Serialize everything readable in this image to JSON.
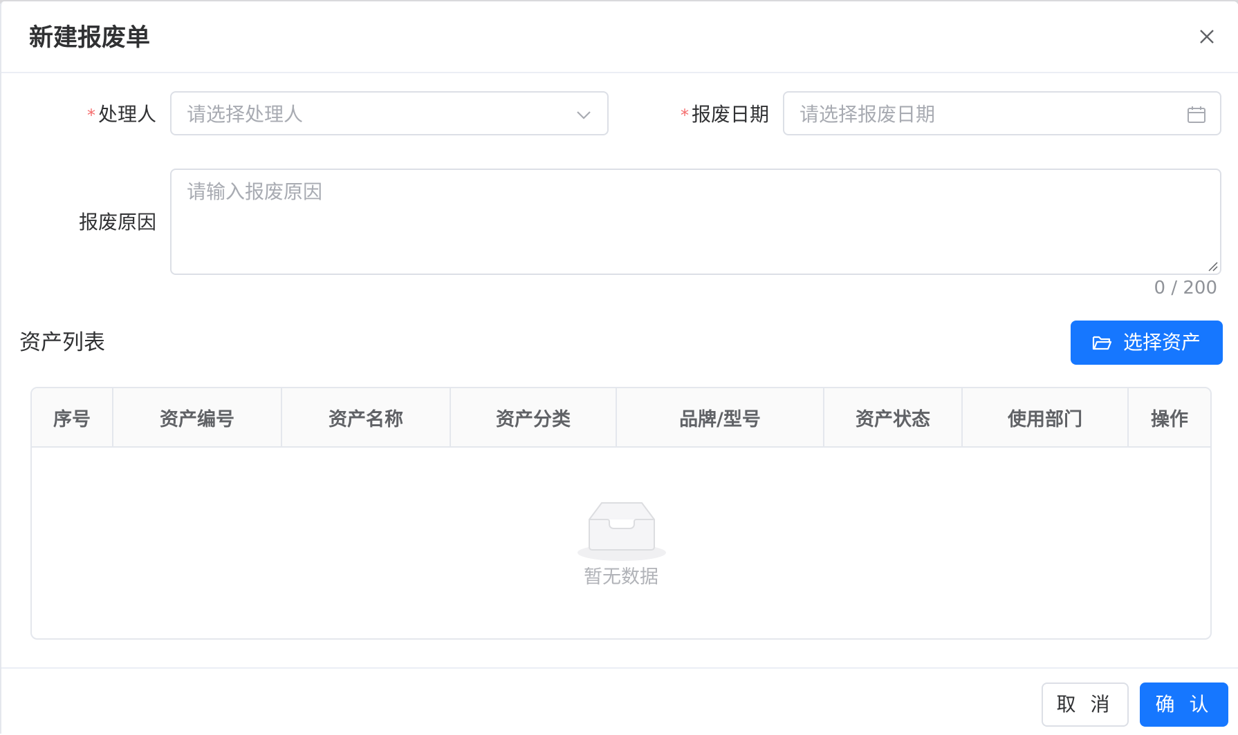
{
  "dialog": {
    "title": "新建报废单"
  },
  "form": {
    "handler": {
      "label": "处理人",
      "required_mark": "*",
      "placeholder": "请选择处理人"
    },
    "scrap_date": {
      "label": "报废日期",
      "required_mark": "*",
      "placeholder": "请选择报废日期"
    },
    "reason": {
      "label": "报废原因",
      "placeholder": "请输入报废原因",
      "counter": "0 / 200"
    }
  },
  "asset_section": {
    "title": "资产列表",
    "select_button": "选择资产"
  },
  "table": {
    "columns": [
      "序号",
      "资产编号",
      "资产名称",
      "资产分类",
      "品牌/型号",
      "资产状态",
      "使用部门",
      "操作"
    ],
    "empty_text": "暂无数据"
  },
  "footer": {
    "cancel": "取 消",
    "confirm": "确 认"
  },
  "colors": {
    "primary": "#1677ff",
    "required": "#f56c6c",
    "border": "#dcdfe6",
    "placeholder": "#a8abb2"
  },
  "icons": {
    "close": "close-icon",
    "select_arrow": "chevron-down-icon",
    "date": "calendar-icon",
    "select_assets": "folder-open-icon",
    "empty": "empty-inbox-icon"
  }
}
